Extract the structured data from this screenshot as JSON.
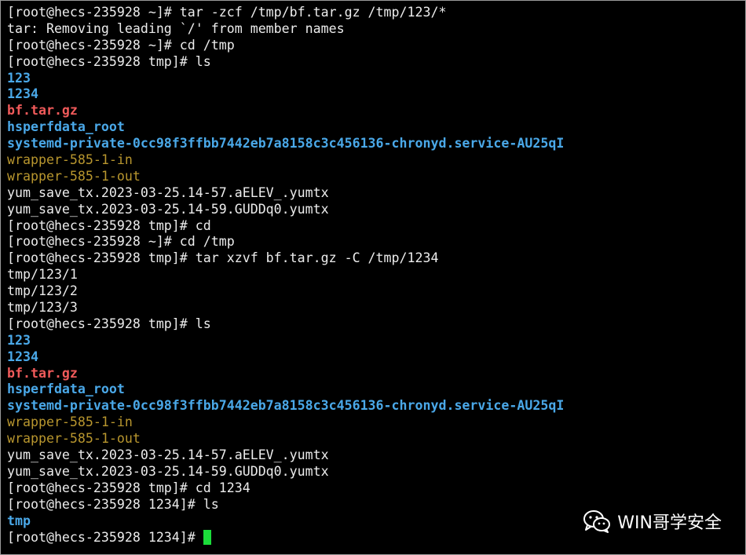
{
  "terminal": {
    "lines": [
      {
        "text": "[root@hecs-235928 ~]# tar -zcf /tmp/bf.tar.gz /tmp/123/*",
        "style": "default"
      },
      {
        "text": "tar: Removing leading `/' from member names",
        "style": "default"
      },
      {
        "text": "[root@hecs-235928 ~]# cd /tmp",
        "style": "default"
      },
      {
        "text": "[root@hecs-235928 tmp]# ls",
        "style": "default"
      },
      {
        "text": "123",
        "style": "dir"
      },
      {
        "text": "1234",
        "style": "dir"
      },
      {
        "text": "bf.tar.gz",
        "style": "archive"
      },
      {
        "text": "hsperfdata_root",
        "style": "dir"
      },
      {
        "text": "systemd-private-0cc98f3ffbb7442eb7a8158c3c456136-chronyd.service-AU25qI",
        "style": "dir"
      },
      {
        "text": "wrapper-585-1-in",
        "style": "fifo"
      },
      {
        "text": "wrapper-585-1-out",
        "style": "fifo"
      },
      {
        "text": "yum_save_tx.2023-03-25.14-57.aELEV_.yumtx",
        "style": "default"
      },
      {
        "text": "yum_save_tx.2023-03-25.14-59.GUDDq0.yumtx",
        "style": "default"
      },
      {
        "text": "[root@hecs-235928 tmp]# cd",
        "style": "default"
      },
      {
        "text": "[root@hecs-235928 ~]# cd /tmp",
        "style": "default"
      },
      {
        "text": "[root@hecs-235928 tmp]# tar xzvf bf.tar.gz -C /tmp/1234",
        "style": "default"
      },
      {
        "text": "tmp/123/1",
        "style": "default"
      },
      {
        "text": "tmp/123/2",
        "style": "default"
      },
      {
        "text": "tmp/123/3",
        "style": "default"
      },
      {
        "text": "[root@hecs-235928 tmp]# ls",
        "style": "default"
      },
      {
        "text": "123",
        "style": "dir"
      },
      {
        "text": "1234",
        "style": "dir"
      },
      {
        "text": "bf.tar.gz",
        "style": "archive"
      },
      {
        "text": "hsperfdata_root",
        "style": "dir"
      },
      {
        "text": "systemd-private-0cc98f3ffbb7442eb7a8158c3c456136-chronyd.service-AU25qI",
        "style": "dir"
      },
      {
        "text": "wrapper-585-1-in",
        "style": "fifo"
      },
      {
        "text": "wrapper-585-1-out",
        "style": "fifo"
      },
      {
        "text": "yum_save_tx.2023-03-25.14-57.aELEV_.yumtx",
        "style": "default"
      },
      {
        "text": "yum_save_tx.2023-03-25.14-59.GUDDq0.yumtx",
        "style": "default"
      },
      {
        "text": "[root@hecs-235928 tmp]# cd 1234",
        "style": "default"
      },
      {
        "text": "[root@hecs-235928 1234]# ls",
        "style": "default"
      },
      {
        "text": "tmp",
        "style": "dir"
      }
    ],
    "prompt": "[root@hecs-235928 1234]# "
  },
  "watermark": {
    "text": "WIN哥学安全",
    "icon": "wechat-icon"
  },
  "colors": {
    "background": "#000000",
    "text": "#ececec",
    "directory": "#4aa8e8",
    "archive": "#f05a5a",
    "fifo": "#b8962e",
    "cursor": "#1bdc3a"
  }
}
